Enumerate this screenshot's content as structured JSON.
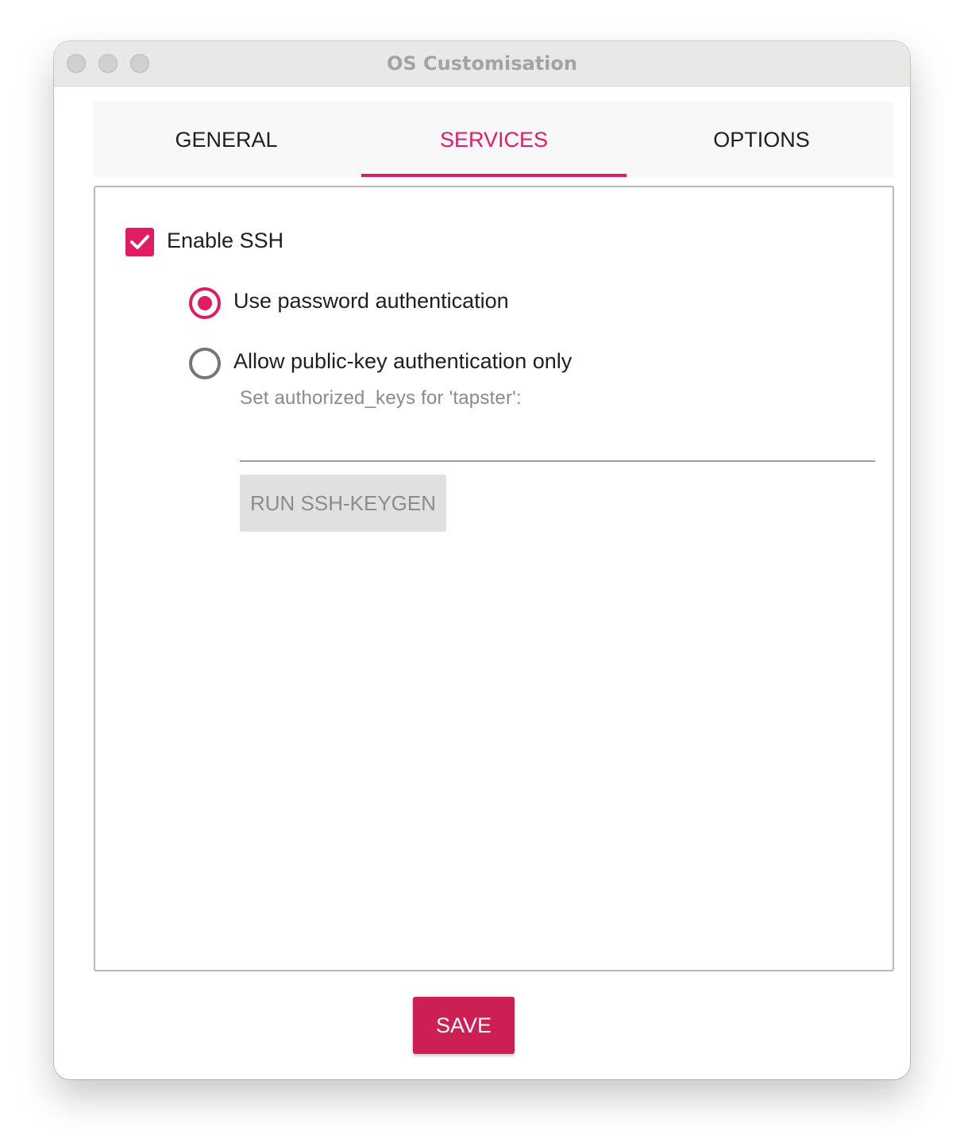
{
  "window": {
    "title": "OS Customisation"
  },
  "tabs": [
    {
      "label": "GENERAL",
      "active": false
    },
    {
      "label": "SERVICES",
      "active": true
    },
    {
      "label": "OPTIONS",
      "active": false
    }
  ],
  "services": {
    "enable_ssh": {
      "label": "Enable SSH",
      "checked": true
    },
    "auth_options": [
      {
        "label": "Use password authentication",
        "selected": true
      },
      {
        "label": "Allow public-key authentication only",
        "selected": false
      }
    ],
    "authorized_keys": {
      "label": "Set authorized_keys for 'tapster':",
      "value": ""
    },
    "keygen_button_label": "RUN SSH-KEYGEN"
  },
  "footer": {
    "save_label": "SAVE"
  },
  "colors": {
    "accent": "#e01d64",
    "save_button": "#cc2054",
    "disabled_button": "#e0e0e0"
  }
}
